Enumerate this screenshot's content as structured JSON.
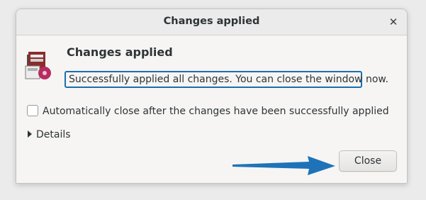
{
  "window": {
    "title": "Changes applied",
    "close_icon": "close-icon"
  },
  "dialog": {
    "heading": "Changes applied",
    "message": "Successfully applied all changes. You can close the window now.",
    "auto_close_label": "Automatically close after the changes have been successfully applied",
    "auto_close_checked": false,
    "details_label": "Details",
    "close_button_label": "Close",
    "icon": "package-disk-icon"
  },
  "colors": {
    "highlight_border": "#1a6fb0",
    "annotation_arrow": "#1e73b8"
  }
}
